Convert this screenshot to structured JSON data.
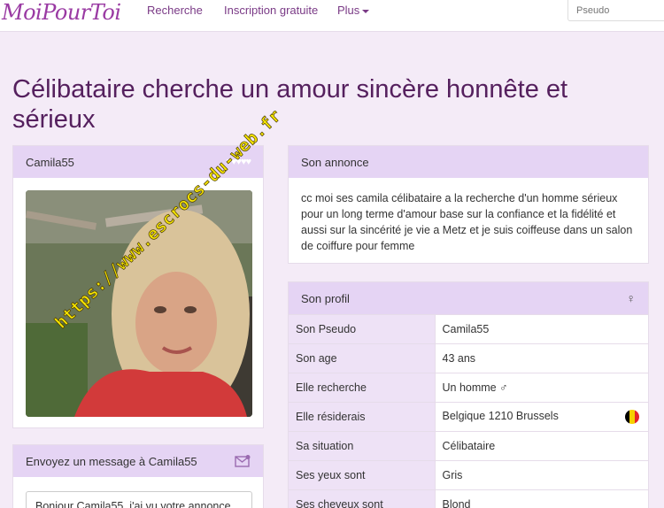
{
  "nav": {
    "logo": "MoiPourToi",
    "links": [
      "Recherche",
      "Inscription gratuite",
      "Plus"
    ],
    "search_placeholder": "Pseudo"
  },
  "page_title": "Célibataire cherche un amour sincère honnête et sérieux",
  "profile_card": {
    "username": "Camila55",
    "hearts": "♥♥♥♥♥",
    "photo_alt": "Camila55"
  },
  "annonce": {
    "heading": "Son annonce",
    "text": "cc moi ses camila célibataire a la recherche d'un homme sérieux pour un long terme d'amour base sur la confiance et la fidélité et aussi sur la sincérité je vie a Metz et je suis coiffeuse dans un salon de coiffure pour femme"
  },
  "profil": {
    "heading": "Son profil",
    "gender_icon": "♀",
    "rows": [
      {
        "label": "Son Pseudo",
        "value": "Camila55"
      },
      {
        "label": "Son age",
        "value": "43 ans"
      },
      {
        "label": "Elle recherche",
        "value": "Un homme ♂"
      },
      {
        "label": "Elle résiderais",
        "value": "Belgique 1210 Brussels"
      },
      {
        "label": "Sa situation",
        "value": "Célibataire"
      },
      {
        "label": "Ses yeux sont",
        "value": "Gris"
      },
      {
        "label": "Ses cheveux sont",
        "value": "Blond"
      }
    ],
    "flag_colors": [
      "#000000",
      "#f5d000",
      "#e5242b"
    ]
  },
  "message": {
    "heading": "Envoyez un message à Camila55",
    "input_value": "Bonjour Camila55, j'ai vu votre annonce"
  },
  "watermark": "https://www.escrocs-du-web.fr",
  "colors": {
    "brand": "#9a3aa3",
    "title": "#55205e",
    "panel_head": "#e5d4f4",
    "background": "#f4ebf7"
  }
}
